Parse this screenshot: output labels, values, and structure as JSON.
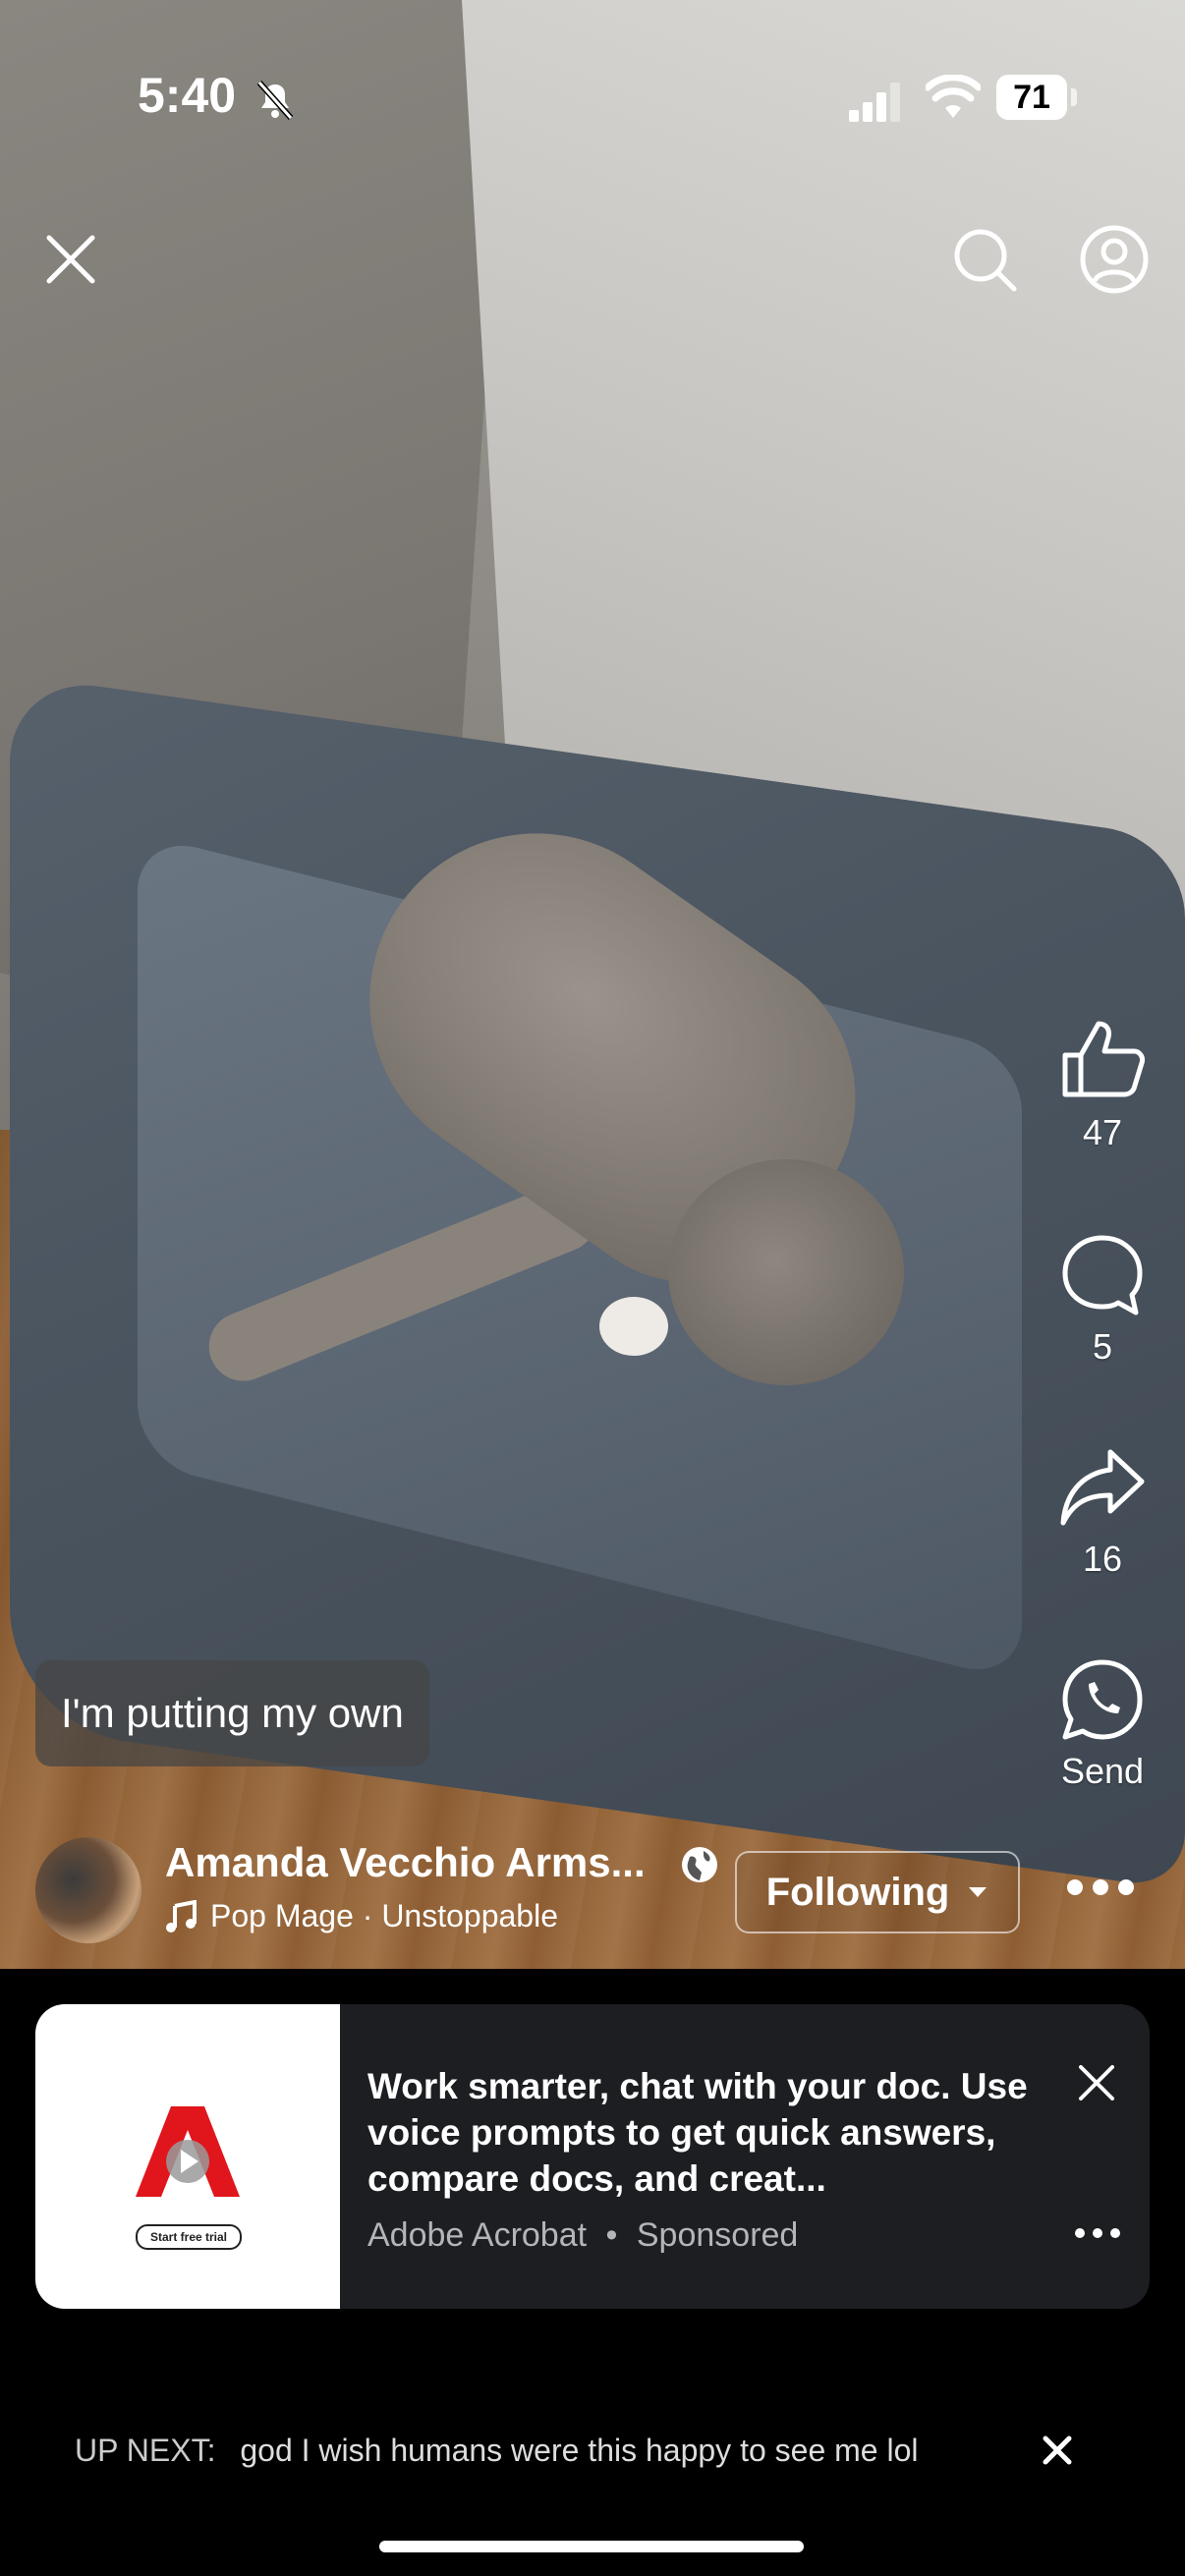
{
  "status_bar": {
    "time": "5:40",
    "battery": "71"
  },
  "actions": {
    "like_count": "47",
    "comment_count": "5",
    "share_count": "16",
    "send_label": "Send"
  },
  "caption": "I'm putting my own",
  "author": {
    "name": "Amanda Vecchio Arms...",
    "audio": "Pop Mage · Unstoppable",
    "follow_label": "Following"
  },
  "ad": {
    "headline": "Work smarter, chat with your doc. Use voice prompts to get quick answers, compare docs, and creat...",
    "advertiser": "Adobe Acrobat",
    "sponsored_label": "Sponsored",
    "meta_separator": "•",
    "cta_label": "Start free trial"
  },
  "up_next": {
    "label": "UP NEXT:",
    "title": "god I wish humans were this happy to see me lol"
  },
  "icons": {
    "close": "close-icon",
    "search": "search-icon",
    "profile": "profile-icon",
    "like": "thumbs-up-icon",
    "comment": "comment-icon",
    "share": "share-icon",
    "send": "send-icon"
  }
}
